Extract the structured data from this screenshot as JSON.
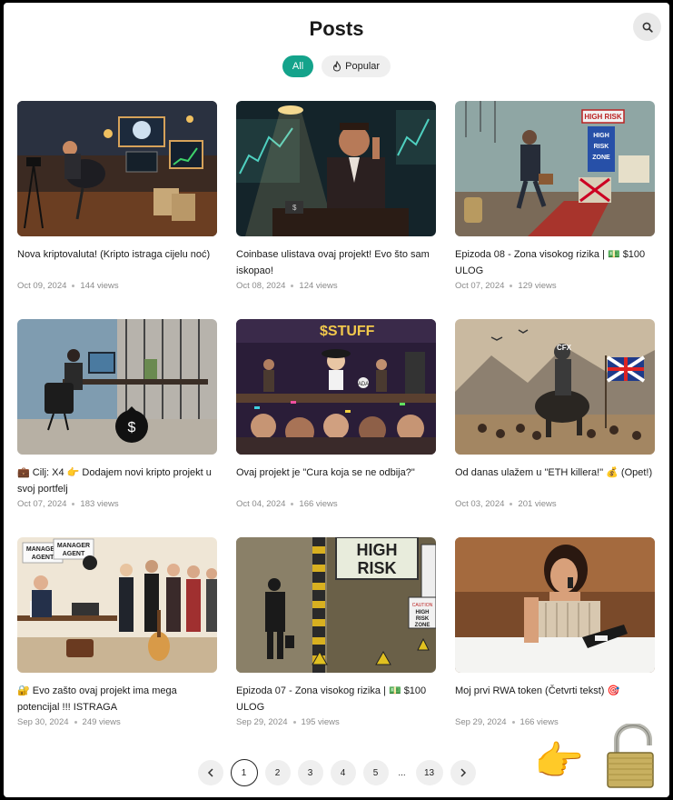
{
  "header": {
    "title": "Posts",
    "search_icon": "search-icon"
  },
  "filters": [
    {
      "label": "All",
      "active": true
    },
    {
      "label": "Popular",
      "icon": "flame-icon",
      "active": false
    }
  ],
  "posts": [
    {
      "title": "Nova kriptovaluta! (Kripto istraga cijelu noć)",
      "date": "Oct 09, 2024",
      "views": "144 views"
    },
    {
      "title": "Coinbase ulistava ovaj projekt! Evo što sam iskopao!",
      "date": "Oct 08, 2024",
      "views": "124 views"
    },
    {
      "title": "Epizoda 08 - Zona visokog rizika | 💵 $100 ULOG",
      "date": "Oct 07, 2024",
      "views": "129 views"
    },
    {
      "title": "💼 Cilj: X4 👉 Dodajem novi kripto projekt u svoj portfelj",
      "date": "Oct 07, 2024",
      "views": "183 views"
    },
    {
      "title": "Ovaj projekt je \"Cura koja se ne odbija?\"",
      "date": "Oct 04, 2024",
      "views": "166 views"
    },
    {
      "title": "Od danas ulažem u \"ETH killera!\" 💰 (Opet!)",
      "date": "Oct 03, 2024",
      "views": "201 views"
    },
    {
      "title": "🔐 Evo zašto ovaj projekt ima mega potencijal !!! ISTRAGA",
      "date": "Sep 30, 2024",
      "views": "249 views"
    },
    {
      "title": "Epizoda 07 - Zona visokog rizika | 💵 $100 ULOG",
      "date": "Sep 29, 2024",
      "views": "195 views"
    },
    {
      "title": "Moj prvi RWA token (Četvrti tekst) 🎯",
      "date": "Sep 29, 2024",
      "views": "166 views"
    }
  ],
  "thumb_text": {
    "t3a": "HIGH RISK",
    "t3b": "HIGH",
    "t3c": "RISK",
    "t3d": "ZONE",
    "t5a": "$STUFF",
    "t5b": "ADA",
    "t6a": "CFX",
    "t7a": "MANAGER",
    "t7b": "AGENT",
    "t7c": "MANAGER",
    "t7d": "AGENT",
    "t8a": "HIGH",
    "t8b": "RISK",
    "t8c": "HIGH",
    "t8d": "RISK",
    "t8e": "ZONE",
    "t8f": "CAUTION",
    "t2a": "$"
  },
  "pagination": {
    "prev_icon": "chevron-left-icon",
    "pages": [
      "1",
      "2",
      "3",
      "4",
      "5"
    ],
    "ellipsis": "...",
    "last": "13",
    "next_icon": "chevron-right-icon",
    "current": "1"
  },
  "overlay": {
    "hand_emoji": "👉",
    "lock_icon": "open-padlock-icon"
  },
  "colors": {
    "accent": "#14a38b",
    "chip_bg": "#efefef",
    "meta": "#8a8a8a"
  }
}
